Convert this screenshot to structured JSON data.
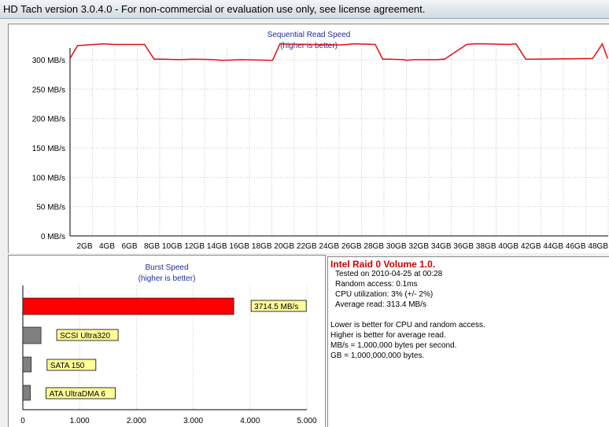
{
  "window": {
    "title": "HD Tach version 3.0.4.0  - For non-commercial or evaluation use only, see license agreement."
  },
  "colors": {
    "line": "#e01010",
    "title_text": "#1f2ea0",
    "burst_bar": "#ff0000",
    "ref_bar": "#808080",
    "label_bg": "#ffff99"
  },
  "sequential": {
    "title": "Sequential Read Speed",
    "subtitle": "(higher is better)",
    "chart_data": {
      "type": "line",
      "title": "Sequential Read Speed",
      "subtitle": "(higher is better)",
      "ylim": [
        0,
        320
      ],
      "xlim": [
        0,
        48
      ],
      "y_ticks": [
        0,
        50,
        100,
        150,
        200,
        250,
        300
      ],
      "y_tick_labels": [
        "0 MB/s",
        "50 MB/s",
        "100 MB/s",
        "150 MB/s",
        "200 MB/s",
        "250 MB/s",
        "300 MB/s"
      ],
      "x_ticks": [
        2,
        4,
        6,
        8,
        10,
        12,
        14,
        16,
        18,
        20,
        22,
        24,
        26,
        28,
        30,
        32,
        34,
        36,
        38,
        40,
        42,
        44,
        46,
        48
      ],
      "x_tick_labels": [
        "2GB",
        "4GB",
        "6GB",
        "8GB",
        "10GB",
        "12GB",
        "14GB",
        "16GB",
        "18GB",
        "20GB",
        "22GB",
        "24GB",
        "26GB",
        "28GB",
        "30GB",
        "32GB",
        "34GB",
        "36GB",
        "38GB",
        "40GB",
        "42GB",
        "44GB",
        "46GB",
        "48GB"
      ],
      "grid": true,
      "series": [
        {
          "x": [
            0,
            1.0,
            3.3,
            4.4,
            6.0,
            10.0,
            11.3,
            12.4,
            14.8,
            16.5,
            19.3,
            20.4,
            23.0,
            27.2,
            28.2,
            36.0,
            37.2,
            38.2,
            41.0,
            42.0,
            42.9,
            44.9,
            45.1,
            46.2,
            49.3,
            50.1,
            50.2,
            53.3,
            54.4,
            55.6,
            59.0,
            59.9,
            61.2,
            62.4,
            70.2,
            71.5,
            72.2
          ],
          "y": [
            302,
            324,
            326,
            327,
            326,
            326,
            301,
            301,
            300,
            301,
            300,
            299,
            300,
            299,
            327,
            325,
            326,
            327,
            326,
            301,
            301,
            300,
            299,
            300,
            300,
            301,
            300,
            326,
            327,
            327,
            326,
            327,
            301,
            301,
            302,
            327,
            302
          ]
        }
      ]
    }
  },
  "burst": {
    "title": "Burst Speed",
    "subtitle": "(higher is better)",
    "chart_data": {
      "type": "bar",
      "orientation": "horizontal",
      "title": "Burst Speed",
      "subtitle": "(higher is better)",
      "xlim": [
        0,
        5000
      ],
      "x_ticks": [
        0,
        1000,
        2000,
        3000,
        4000,
        5000
      ],
      "x_tick_labels": [
        "0",
        "1.000",
        "2.000",
        "3.000",
        "4.000",
        "5.000"
      ],
      "grid": true,
      "categories": [
        "3714.5 MB/s",
        "SCSI Ultra320",
        "SATA 150",
        "ATA UltraDMA 6"
      ],
      "values": [
        3714.5,
        320,
        150,
        133
      ]
    }
  },
  "info": {
    "title": "Intel Raid 0 Volume 1.0.",
    "lines": [
      "Tested on 2010-04-25 at 00:28",
      "Random access: 0.1ms",
      "CPU utilization: 3% (+/- 2%)",
      "Average read: 313.4 MB/s"
    ],
    "notes": [
      "Lower is better for CPU and random access.",
      "Higher is better for average read.",
      "MB/s = 1,000,000 bytes per second.",
      "GB = 1,000,000,000 bytes."
    ]
  }
}
